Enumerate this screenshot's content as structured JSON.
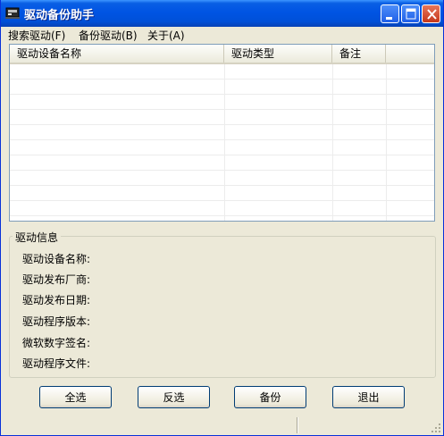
{
  "window": {
    "title": "驱动备份助手"
  },
  "menu": [
    {
      "label": "搜索驱动(F)"
    },
    {
      "label": "备份驱动(B)"
    },
    {
      "label": "关于(A)"
    }
  ],
  "listview": {
    "columns": [
      {
        "label": "驱动设备名称"
      },
      {
        "label": "驱动类型"
      },
      {
        "label": "备注"
      }
    ],
    "rows": []
  },
  "driver_info": {
    "legend": "驱动信息",
    "fields": [
      {
        "label": "驱动设备名称:",
        "value": ""
      },
      {
        "label": "驱动发布厂商:",
        "value": ""
      },
      {
        "label": "驱动发布日期:",
        "value": ""
      },
      {
        "label": "驱动程序版本:",
        "value": ""
      },
      {
        "label": "微软数字签名:",
        "value": ""
      },
      {
        "label": "驱动程序文件:",
        "value": ""
      }
    ]
  },
  "buttons": {
    "select_all": "全选",
    "invert": "反选",
    "backup": "备份",
    "exit": "退出"
  },
  "colors": {
    "titlebar": "#0054e3",
    "background": "#ece9d8",
    "border": "#7f9db9"
  },
  "icons": {
    "app": "driver-app-icon",
    "minimize": "minimize-icon",
    "maximize": "maximize-icon",
    "close": "close-icon"
  }
}
